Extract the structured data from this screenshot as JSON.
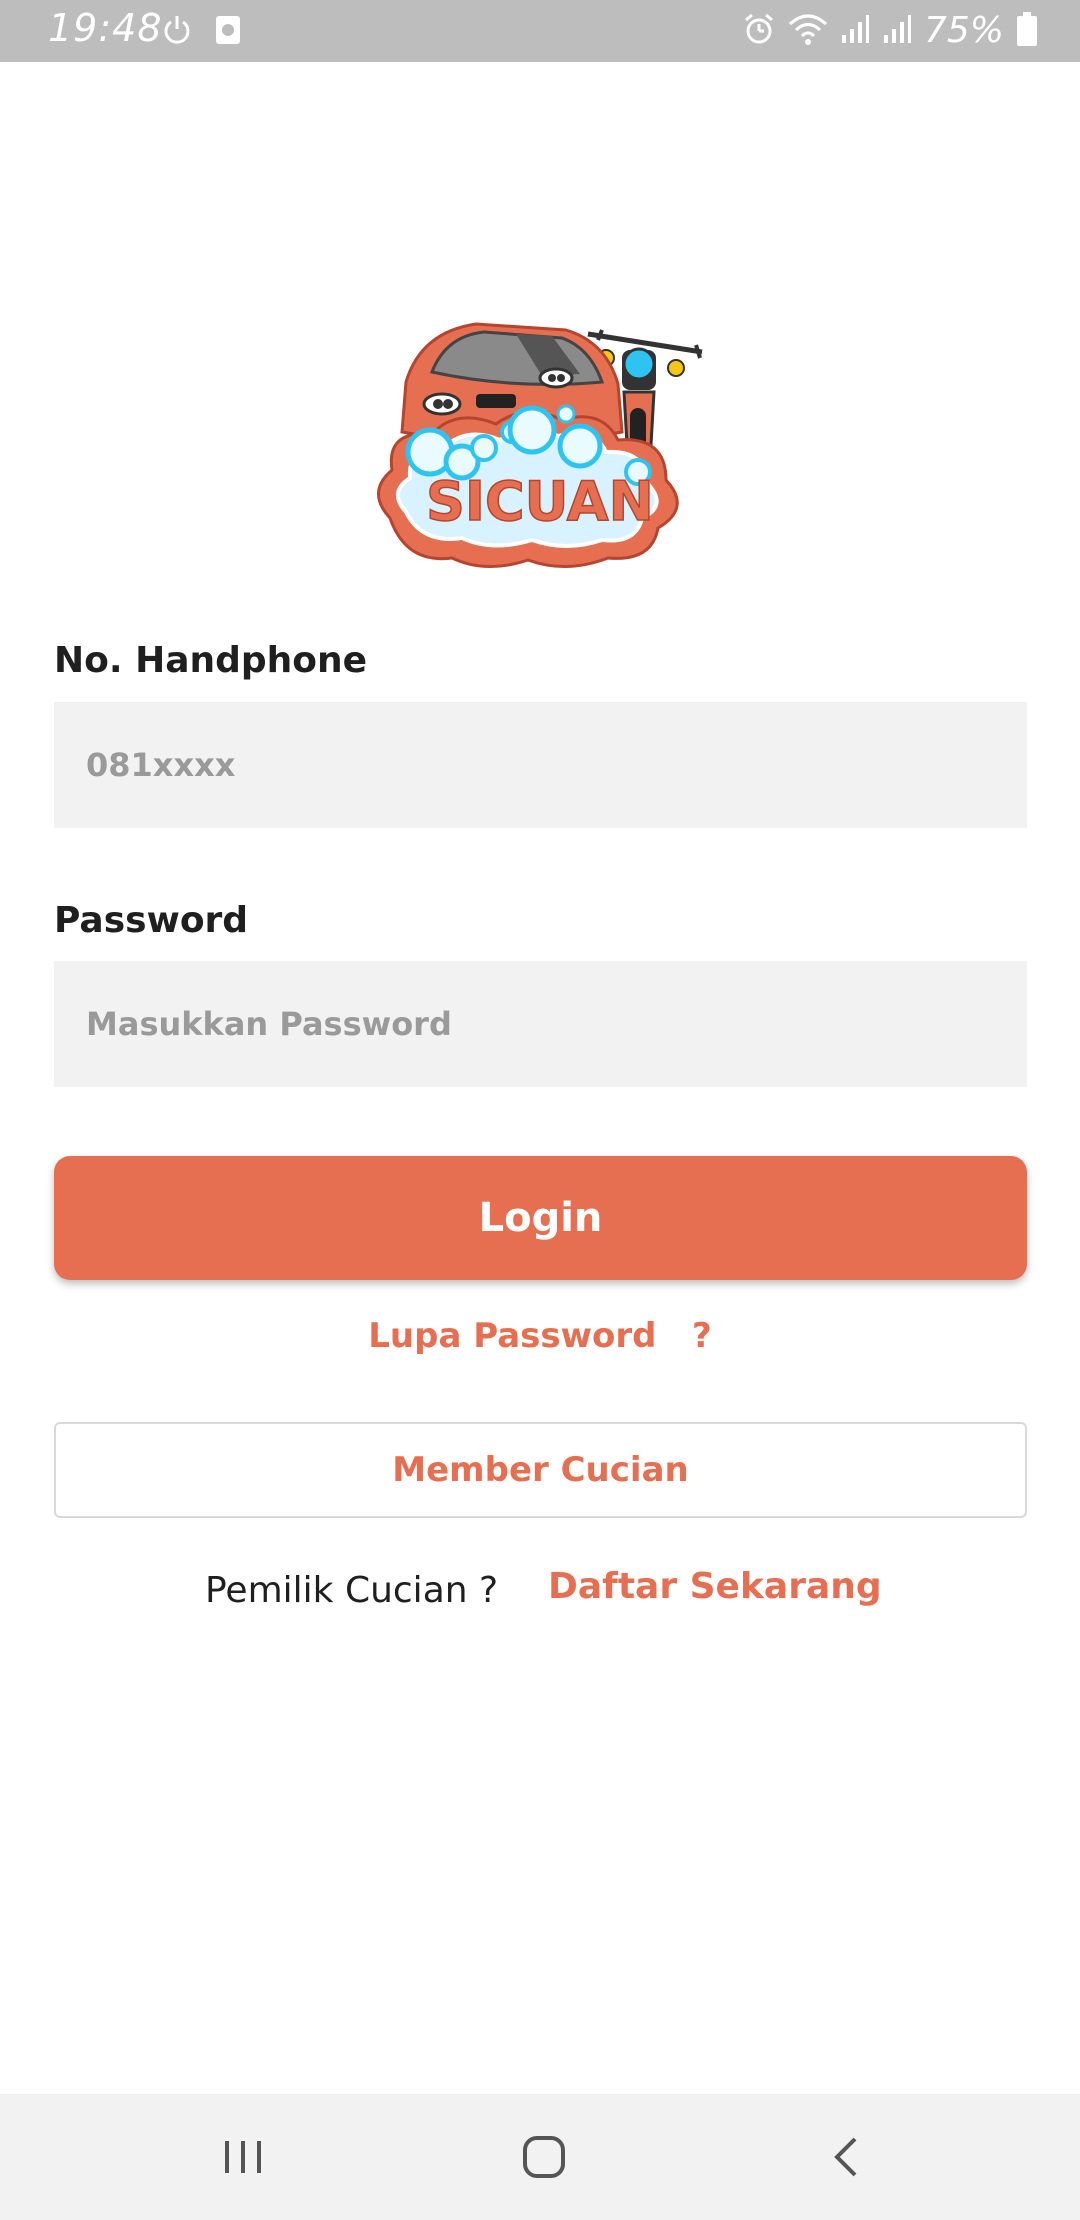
{
  "status_bar": {
    "time": "19:48",
    "battery": "75%",
    "icons": [
      "power-icon",
      "screenshot-icon",
      "alarm-icon",
      "wifi-icon",
      "signal-icon",
      "signal-icon",
      "battery-icon"
    ]
  },
  "logo": {
    "text": "SICUAN"
  },
  "form": {
    "phone_label": "No. Handphone",
    "phone_placeholder": "081xxxx",
    "password_label": "Password",
    "password_placeholder": "Masukkan Password"
  },
  "actions": {
    "login_label": "Login",
    "forgot_label": "Lupa Password   ?",
    "member_label": "Member Cucian",
    "owner_question": "Pemilik Cucian ?",
    "register_label": "Daftar Sekarang"
  },
  "nav_bar": {
    "icons": [
      "recents-icon",
      "home-icon",
      "back-icon"
    ]
  },
  "colors": {
    "accent": "#e76f51",
    "input_bg": "#f2f2f2",
    "status_bar": "#bdbdbd"
  }
}
